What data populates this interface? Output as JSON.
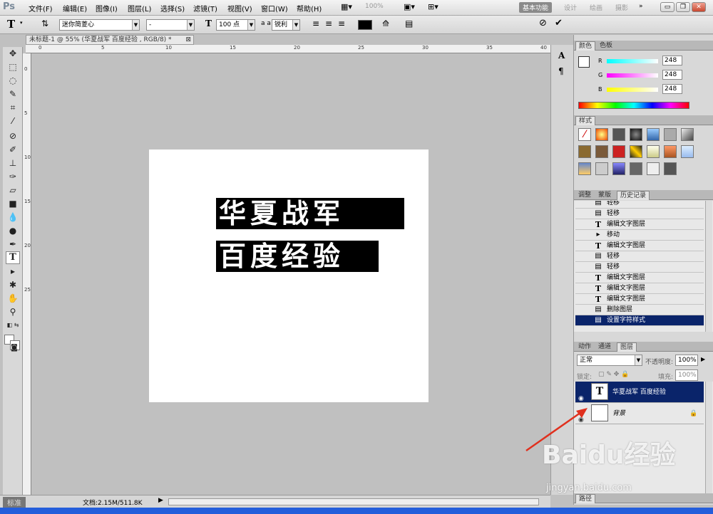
{
  "app": {
    "logo": "Ps"
  },
  "menu": [
    "文件(F)",
    "编辑(E)",
    "图像(I)",
    "图层(L)",
    "选择(S)",
    "滤镜(T)",
    "视图(V)",
    "窗口(W)",
    "帮助(H)"
  ],
  "menubar": {
    "zoom_display": "100%"
  },
  "workspaces": [
    "基本功能",
    "设计",
    "绘画",
    "摄影"
  ],
  "options": {
    "font_family": "迷你简菱心",
    "font_style": "-",
    "font_size": "100 点",
    "antialias_label": "a a",
    "antialias": "锐利",
    "text_color": "#000000"
  },
  "document": {
    "tab_title": "未标题-1 @ 55% (华夏战军 百度经验 , RGB/8) *",
    "text_line1": "华夏战军",
    "text_line2": "百度经验",
    "ruler_top": [
      "0",
      "5",
      "10",
      "15",
      "20",
      "25",
      "30",
      "35",
      "40"
    ],
    "ruler_left": [
      "0",
      "5",
      "10",
      "15",
      "20",
      "25"
    ]
  },
  "status": {
    "doc_info": "文档:2.15M/511.8K",
    "standard_tab": "标准"
  },
  "color_panel": {
    "tabs": [
      "颜色",
      "色板"
    ],
    "r_label": "R",
    "g_label": "G",
    "b_label": "B",
    "r": "248",
    "g": "248",
    "b": "248"
  },
  "styles_panel": {
    "tab": "样式"
  },
  "history_panel": {
    "tabs": [
      "调整",
      "蒙版",
      "历史记录"
    ],
    "items": [
      "轻移",
      "轻移",
      "编辑文字图层",
      "移动",
      "编辑文字图层",
      "轻移",
      "轻移",
      "编辑文字图层",
      "编辑文字图层",
      "编辑文字图层",
      "删除图层",
      "设置字符样式"
    ]
  },
  "layers_panel": {
    "tabs": [
      "动作",
      "通道",
      "图层"
    ],
    "blend_mode": "正常",
    "opacity_label": "不透明度:",
    "opacity": "100%",
    "lock_label": "锁定:",
    "fill_label": "填充:",
    "fill": "100%",
    "layers": [
      {
        "name": "华夏战军 百度经验",
        "thumb": "T"
      },
      {
        "name": "背景",
        "thumb": ""
      }
    ]
  },
  "paths_tab": "路径",
  "watermark": {
    "brand": "Baidu经验",
    "url": "jingyan.baidu.com"
  }
}
